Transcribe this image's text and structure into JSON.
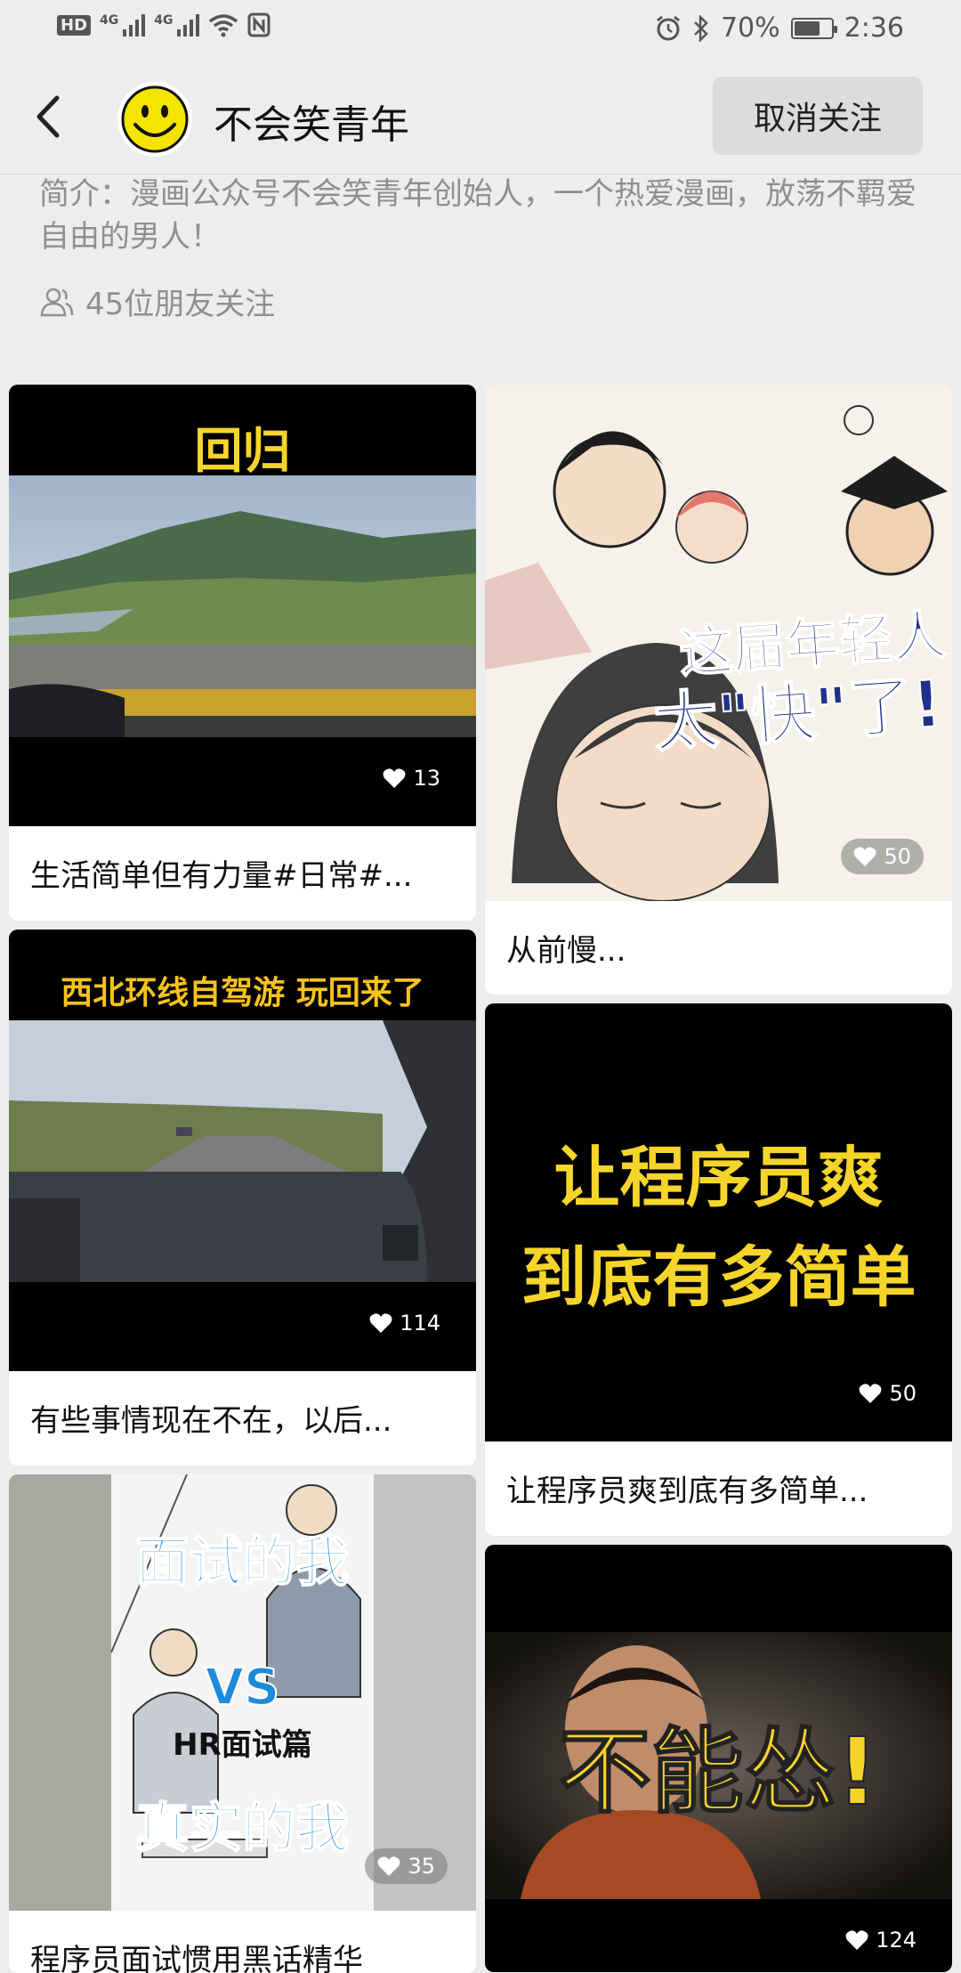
{
  "status_bar": {
    "hd": "HD",
    "net1": "4G",
    "net2": "4G",
    "battery": "70%",
    "battery_level": 0.7,
    "time": "2:36"
  },
  "header": {
    "title": "不会笑青年",
    "unfollow_label": "取消关注"
  },
  "profile": {
    "bio": "简介：漫画公众号不会笑青年创始人，一个热爱漫画，放荡不羁爱自由的男人！",
    "followers": "45位朋友关注"
  },
  "posts": [
    {
      "caption": "生活简单但有力量#日常#...",
      "likes": "13",
      "overlay": "回归"
    },
    {
      "caption": "从前慢...",
      "likes": "50",
      "overlay_line1": "这届年轻人",
      "overlay_line2": "太\"快\"了!"
    },
    {
      "caption": "有些事情现在不在，以后...",
      "likes": "114",
      "overlay": "西北环线自驾游 玩回来了"
    },
    {
      "caption": "让程序员爽到底有多简单...",
      "likes": "50",
      "overlay_line1": "让程序员爽",
      "overlay_line2": "到底有多简单"
    },
    {
      "caption": "程序员面试惯用黑话精华",
      "likes": "35",
      "overlay_line1": "面试的我",
      "overlay_vs": "VS",
      "overlay_sub": "HR面试篇",
      "overlay_line2": "真实的我"
    },
    {
      "caption": "",
      "likes": "124",
      "overlay": "不能怂!"
    }
  ]
}
